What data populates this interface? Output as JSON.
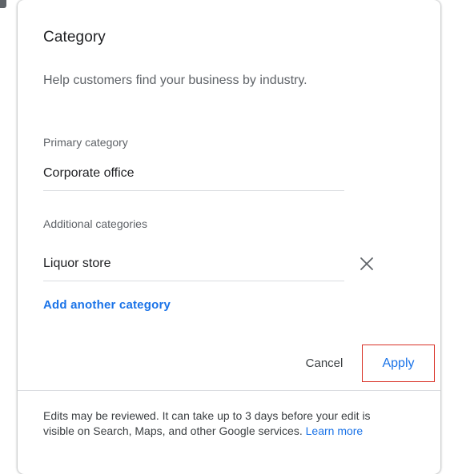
{
  "dialog": {
    "title": "Category",
    "subtitle": "Help customers find your business by industry."
  },
  "primary": {
    "label": "Primary category",
    "value": "Corporate office"
  },
  "additional": {
    "label": "Additional categories",
    "items": [
      {
        "value": "Liquor store",
        "remove_icon": "close-icon"
      }
    ],
    "add_label": "Add another category"
  },
  "actions": {
    "cancel_label": "Cancel",
    "apply_label": "Apply"
  },
  "footer": {
    "text": "Edits may be reviewed. It can take up to 3 days before your edit is visible on Search, Maps, and other Google services.",
    "link_label": "Learn more"
  },
  "colors": {
    "accent": "#1a73e8",
    "highlight": "#d93025",
    "text": "#202124",
    "secondary_text": "#5f6368",
    "divider": "#dadce0"
  }
}
